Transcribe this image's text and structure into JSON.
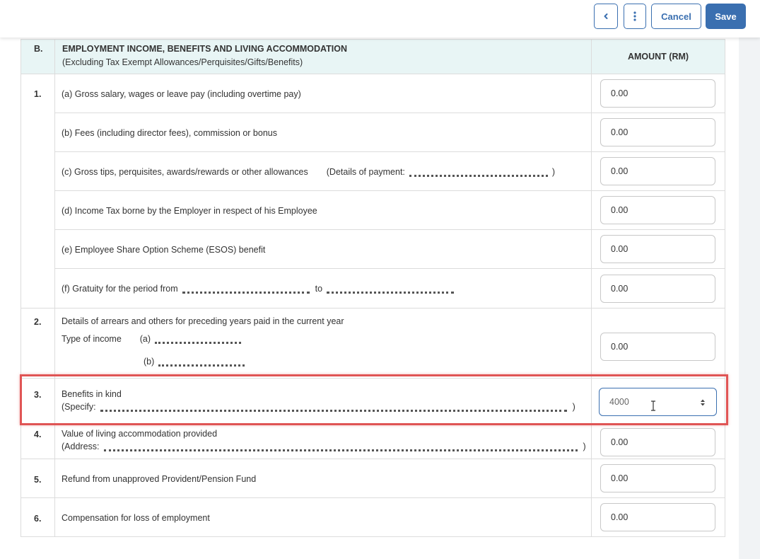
{
  "toolbar": {
    "back_icon": "chevron-left-icon",
    "more_icon": "more-vertical-icon",
    "cancel_label": "Cancel",
    "save_label": "Save"
  },
  "section": {
    "code": "B.",
    "title": "EMPLOYMENT INCOME, BENEFITS AND LIVING ACCOMMODATION",
    "subtitle": "(Excluding Tax Exempt Allowances/Perquisites/Gifts/Benefits)",
    "amount_header": "AMOUNT (RM)"
  },
  "item1": {
    "num": "1.",
    "a": {
      "label": "(a)  Gross salary, wages or leave pay (including overtime pay)",
      "value": "0.00"
    },
    "b": {
      "label": "(b)  Fees (including director fees), commission or bonus",
      "value": "0.00"
    },
    "c": {
      "label": "(c)  Gross tips, perquisites, awards/rewards or other allowances",
      "details_label": "(Details of payment:",
      "close": ")",
      "value": "0.00"
    },
    "d": {
      "label": "(d)  Income Tax borne by the Employer in respect of his Employee",
      "value": "0.00"
    },
    "e": {
      "label": "(e)  Employee Share Option Scheme (ESOS) benefit",
      "value": "0.00"
    },
    "f": {
      "label": "(f)  Gratuity for the period from",
      "to_label": "to",
      "value": "0.00"
    }
  },
  "item2": {
    "num": "2.",
    "label": "Details of arrears and others for preceding years paid in the current year",
    "type_label": "Type of income",
    "a": "(a)",
    "b": "(b)",
    "value": "0.00"
  },
  "item3": {
    "num": "3.",
    "label": "Benefits in kind",
    "specify_label": "(Specify:",
    "close": ")",
    "value": "4000"
  },
  "item4": {
    "num": "4.",
    "label": "Value of living accommodation provided",
    "address_label": "(Address:",
    "close": ")",
    "value": "0.00"
  },
  "item5": {
    "num": "5.",
    "label": "Refund from unapproved Provident/Pension Fund",
    "value": "0.00"
  },
  "item6": {
    "num": "6.",
    "label": "Compensation for loss of employment",
    "value": "0.00"
  },
  "colors": {
    "primary": "#3a6fb0",
    "header_bg": "#e8f5f5",
    "highlight": "#e05555"
  }
}
